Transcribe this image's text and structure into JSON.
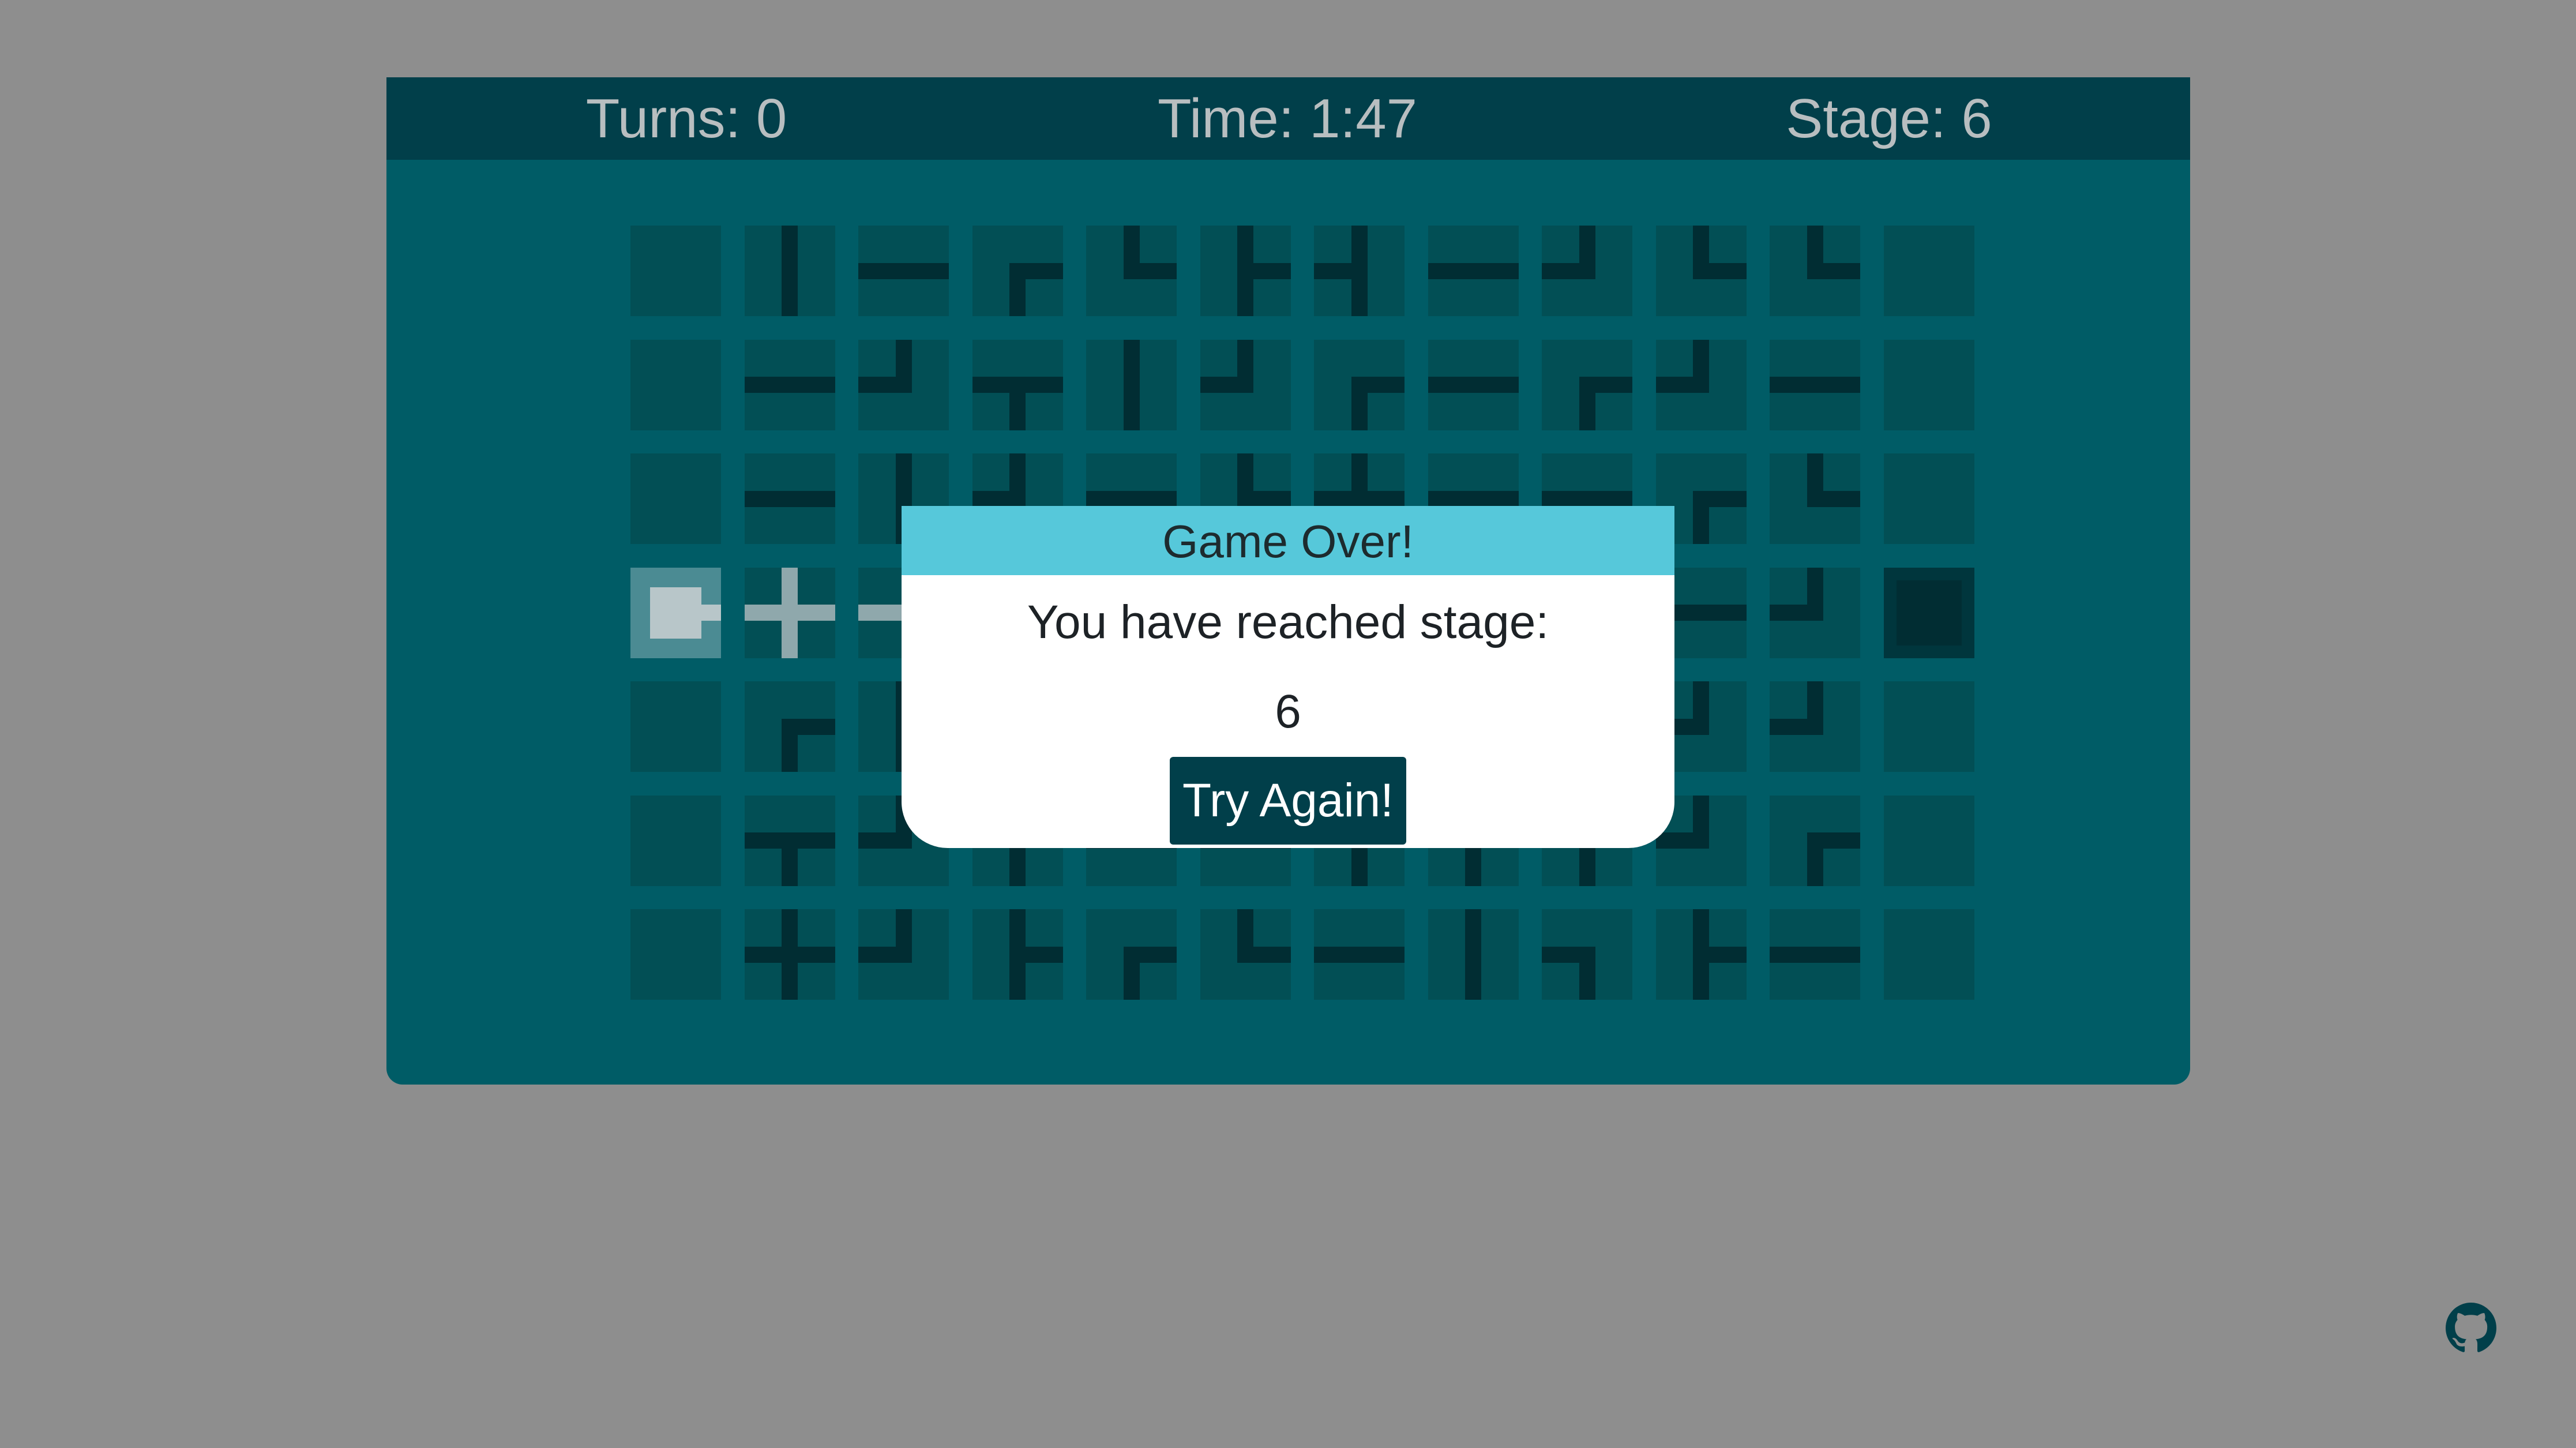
{
  "header": {
    "turns": "Turns: 0",
    "time": "Time: 1:47",
    "stage": "Stage: 6"
  },
  "board": {
    "rows": 7,
    "cols": 12,
    "tiles": [
      [
        "empty",
        "v",
        "h",
        "rd",
        "ur",
        "urd",
        "uld",
        "h",
        "ul",
        "ur",
        "ur",
        "empty"
      ],
      [
        "empty",
        "h",
        "ul",
        "ldr",
        "v",
        "ul",
        "rd",
        "h",
        "rd",
        "ul",
        "h",
        "empty"
      ],
      [
        "empty",
        "h",
        "v",
        "ul",
        "h",
        "ur",
        "lur",
        "h",
        "h",
        "rd",
        "ur",
        "empty"
      ],
      [
        "source",
        "cross",
        "h",
        "h",
        "h",
        "h",
        "h",
        "h",
        "h",
        "h",
        "ul",
        "sink"
      ],
      [
        "empty",
        "rd",
        "v",
        "v",
        "h",
        "h",
        "h",
        "h",
        "h",
        "ul",
        "ul",
        "empty"
      ],
      [
        "empty",
        "ldr",
        "ul",
        "v",
        "h",
        "h",
        "v",
        "v",
        "v",
        "ul",
        "rd",
        "empty"
      ],
      [
        "empty",
        "cross",
        "ul",
        "urd",
        "rd",
        "ur",
        "h",
        "v",
        "ld",
        "urd",
        "h",
        "empty"
      ]
    ],
    "lit_tiles": [
      [
        3,
        0
      ],
      [
        3,
        1
      ],
      [
        3,
        2
      ]
    ]
  },
  "colors": {
    "background": "#8e8e8e",
    "panel": "#005c66",
    "header_bar": "#013f4a",
    "tile": "#024f55",
    "pipe": "#012d33",
    "lit_pipe": "#8fa8ac",
    "modal_title_bar": "#56c8da",
    "button": "#013f4a"
  },
  "modal": {
    "title": "Game Over!",
    "message": "You have reached stage:",
    "stage_value": "6",
    "button_label": "Try Again!"
  },
  "footer": {
    "github_icon": "github-icon"
  }
}
